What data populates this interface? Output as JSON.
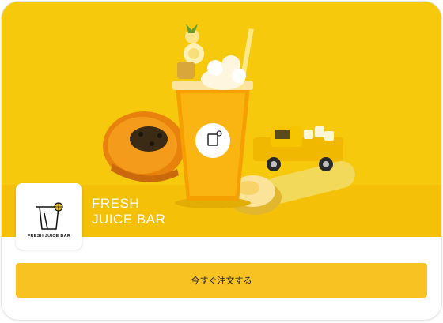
{
  "hero": {
    "image_icon": "juice-photo",
    "background_color": "#f7c90d",
    "cup_label": "FRESH JUICE BAR"
  },
  "brand": {
    "logo_icon": "juice-cup-logo-icon",
    "logo_caption": "FRESH JUICE BAR",
    "line1": "FRESH",
    "line2": "JUICE BAR"
  },
  "order_button": {
    "label": "今すぐ注文する",
    "color": "#f7c222"
  }
}
